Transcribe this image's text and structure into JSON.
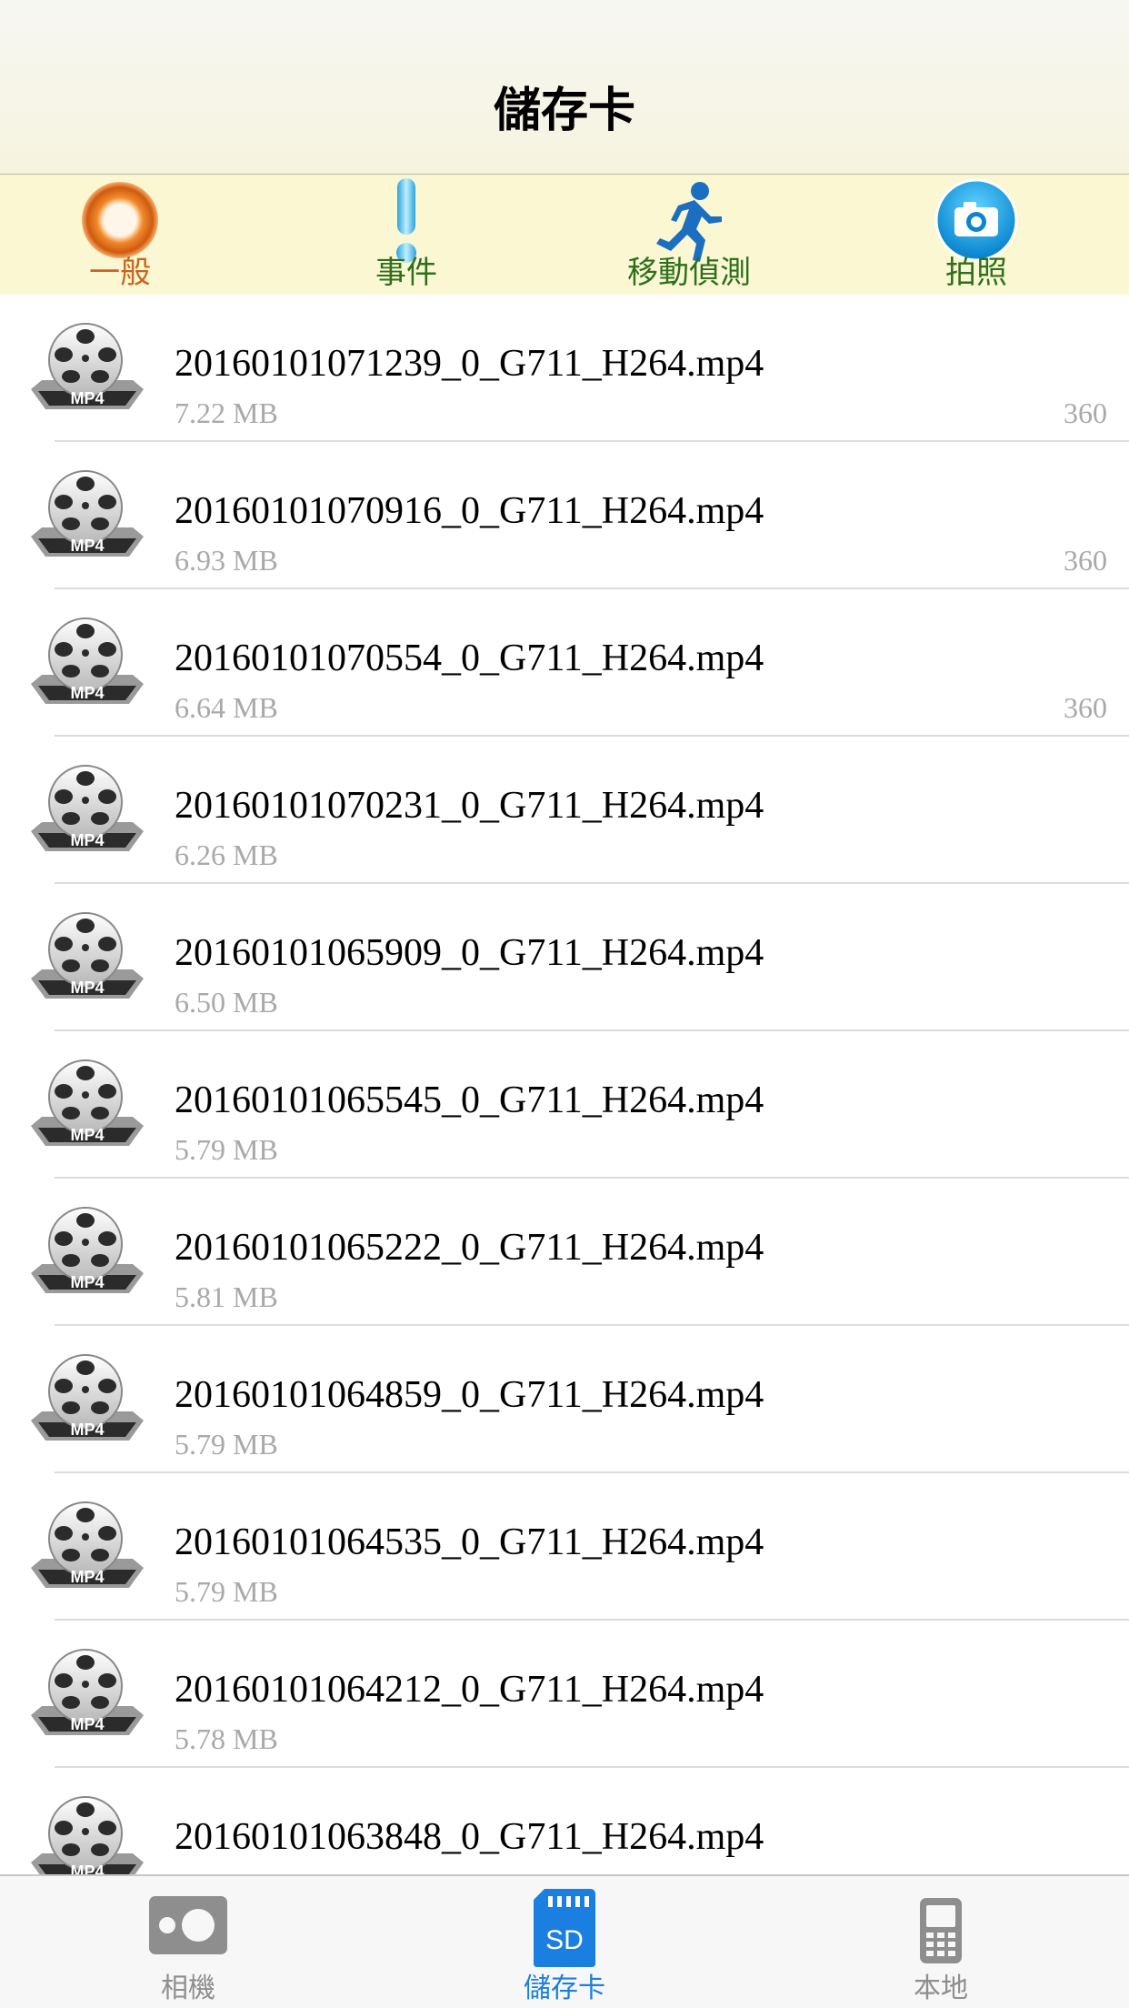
{
  "navbar": {
    "title": "儲存卡"
  },
  "categories": [
    {
      "label": "一般",
      "icon": "ring-icon",
      "active": true
    },
    {
      "label": "事件",
      "icon": "exclamation-icon",
      "active": false
    },
    {
      "label": "移動偵測",
      "icon": "running-man-icon",
      "active": false
    },
    {
      "label": "拍照",
      "icon": "camera-icon",
      "active": false
    }
  ],
  "files": [
    {
      "name": "20160101071239_0_G711_H264.mp4",
      "size": "7.22 MB",
      "tag": "360"
    },
    {
      "name": "20160101070916_0_G711_H264.mp4",
      "size": "6.93 MB",
      "tag": "360"
    },
    {
      "name": "20160101070554_0_G711_H264.mp4",
      "size": "6.64 MB",
      "tag": "360"
    },
    {
      "name": "20160101070231_0_G711_H264.mp4",
      "size": "6.26 MB",
      "tag": ""
    },
    {
      "name": "20160101065909_0_G711_H264.mp4",
      "size": "6.50 MB",
      "tag": ""
    },
    {
      "name": "20160101065545_0_G711_H264.mp4",
      "size": "5.79 MB",
      "tag": ""
    },
    {
      "name": "20160101065222_0_G711_H264.mp4",
      "size": "5.81 MB",
      "tag": ""
    },
    {
      "name": "20160101064859_0_G711_H264.mp4",
      "size": "5.79 MB",
      "tag": ""
    },
    {
      "name": "20160101064535_0_G711_H264.mp4",
      "size": "5.79 MB",
      "tag": ""
    },
    {
      "name": "20160101064212_0_G711_H264.mp4",
      "size": "5.78 MB",
      "tag": ""
    },
    {
      "name": "20160101063848_0_G711_H264.mp4",
      "size": "",
      "tag": ""
    }
  ],
  "file_icon_badge": "MP4",
  "tabs": [
    {
      "label": "相機",
      "icon": "camera-body-icon",
      "active": false
    },
    {
      "label": "儲存卡",
      "icon": "sd-card-icon",
      "active": true,
      "badge": "SD"
    },
    {
      "label": "本地",
      "icon": "phone-icon",
      "active": false
    }
  ],
  "colors": {
    "accent": "#1a7fe0",
    "category_active": "#c8651f",
    "category_text": "#2e6f1c",
    "category_bar": "#fbf7d3"
  }
}
